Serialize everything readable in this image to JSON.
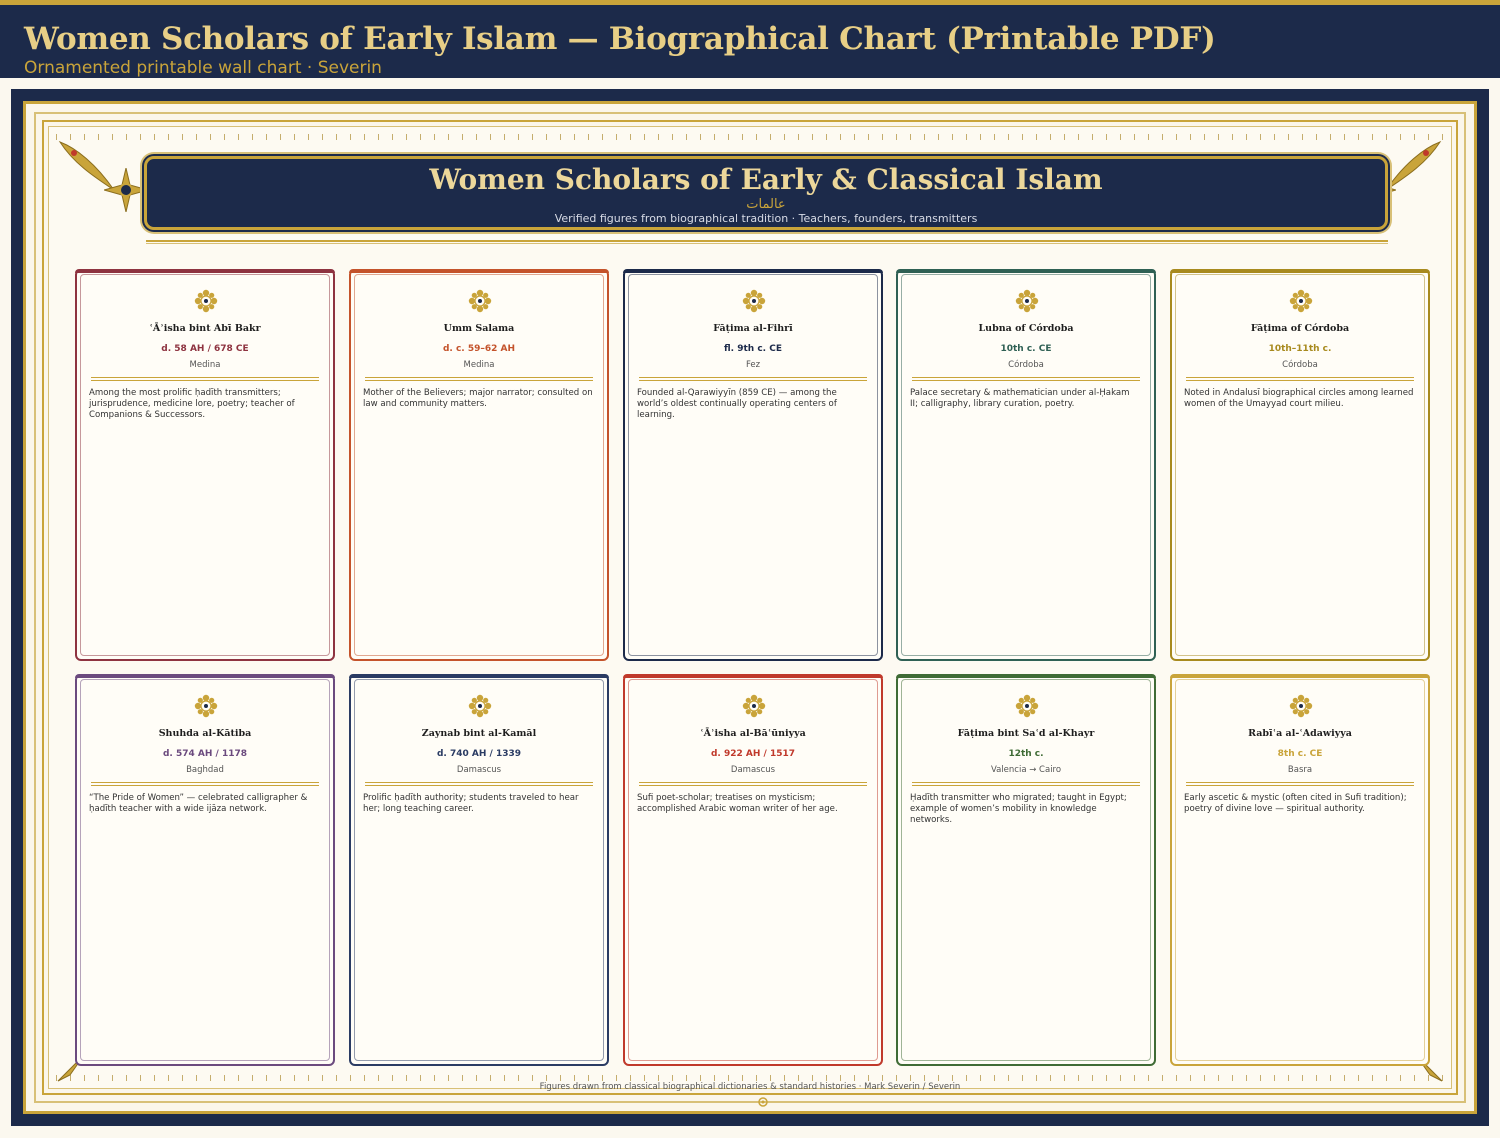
{
  "header": {
    "title": "Women Scholars of Early Islam — Biographical Chart (Printable PDF)",
    "subtitle": "Ornamented printable wall chart  ·  Severin"
  },
  "poster": {
    "title": "Women Scholars of Early & Classical Islam",
    "arabic": "عالمات",
    "subtitle": "Verified figures from biographical tradition  ·  Teachers, founders, transmitters",
    "footer": "Figures drawn from classical biographical dictionaries & standard histories · Mark Severin / Severin"
  },
  "colors": {
    "navy": "#1c2a4a",
    "gold": "#c9a43a",
    "cream": "#fbf6ea"
  },
  "cards": [
    {
      "name": "ʿĀʾisha bint Abī Bakr",
      "date": "d. 58 AH / 678 CE",
      "place": "Medina",
      "desc": "Among the most prolific ḥadīth transmitters; jurisprudence, medicine lore, poetry; teacher of Companions & Successors.",
      "color": "#8e3340"
    },
    {
      "name": "Umm Salama",
      "date": "d. c. 59–62 AH",
      "place": "Medina",
      "desc": "Mother of the Believers; major narrator; consulted on law and community matters.",
      "color": "#c4532b"
    },
    {
      "name": "Fāṭima al-Fihrī",
      "date": "fl. 9th c. CE",
      "place": "Fez",
      "desc": "Founded al-Qarawiyyīn (859 CE) — among the world’s oldest continually operating centers of learning.",
      "color": "#1c2a4a"
    },
    {
      "name": "Lubna of Córdoba",
      "date": "10th c. CE",
      "place": "Córdoba",
      "desc": "Palace secretary & mathematician under al-Ḥakam II; calligraphy, library curation, poetry.",
      "color": "#2f6054"
    },
    {
      "name": "Fāṭima of Córdoba",
      "date": "10th–11th c.",
      "place": "Córdoba",
      "desc": "Noted in Andalusī biographical circles among learned women of the Umayyad court milieu.",
      "color": "#a88a1e"
    },
    {
      "name": "Shuhda al-Kātiba",
      "date": "d. 574 AH / 1178",
      "place": "Baghdad",
      "desc": "“The Pride of Women” — celebrated calligrapher & ḥadīth teacher with a wide ijāza network.",
      "color": "#6b4a7e"
    },
    {
      "name": "Zaynab bint al-Kamāl",
      "date": "d. 740 AH / 1339",
      "place": "Damascus",
      "desc": "Prolific ḥadīth authority; students traveled to hear her; long teaching career.",
      "color": "#2a3b63"
    },
    {
      "name": "ʿĀʾisha al-Bāʿūniyya",
      "date": "d. 922 AH / 1517",
      "place": "Damascus",
      "desc": "Sufi poet-scholar; treatises on mysticism; accomplished Arabic woman writer of her age.",
      "color": "#c0392b"
    },
    {
      "name": "Fāṭima bint Saʿd al-Khayr",
      "date": "12th c.",
      "place": "Valencia → Cairo",
      "desc": "Ḥadīth transmitter who migrated; taught in Egypt; example of women’s mobility in knowledge networks.",
      "color": "#3f6b35"
    },
    {
      "name": "Rabīʿa al-ʿAdawiyya",
      "date": "8th c. CE",
      "place": "Basra",
      "desc": "Early ascetic & mystic (often cited in Sufi tradition); poetry of divine love — spiritual authority.",
      "color": "#c9a43a"
    }
  ]
}
